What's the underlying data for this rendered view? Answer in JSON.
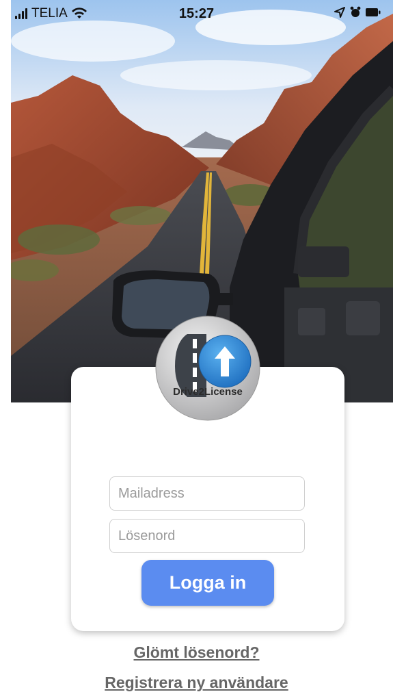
{
  "status_bar": {
    "carrier": "TELIA",
    "time": "15:27",
    "icons": [
      "signal-icon",
      "wifi-icon",
      "location-icon",
      "alarm-icon",
      "battery-icon"
    ]
  },
  "logo": {
    "text": "Drive2License"
  },
  "login_form": {
    "email_placeholder": "Mailadress",
    "password_placeholder": "Lösenord",
    "login_label": "Logga in"
  },
  "links": {
    "forgot_password": "Glömt lösenord?",
    "register": "Registrera ny användare"
  },
  "colors": {
    "primary_button": "#5b8cf0",
    "link": "#666666"
  }
}
